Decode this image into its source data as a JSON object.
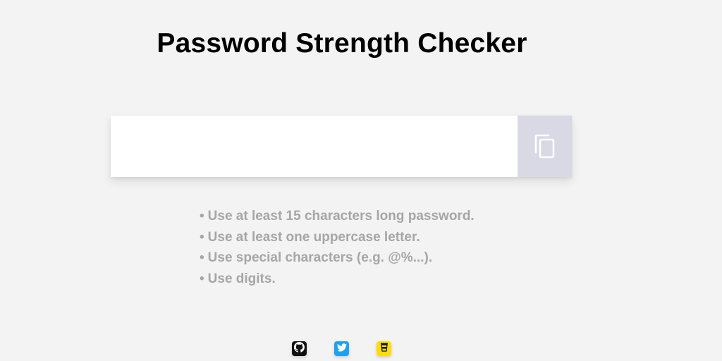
{
  "header": {
    "title": "Password Strength Checker"
  },
  "password_field": {
    "value": "",
    "placeholder": ""
  },
  "copy_button": {
    "icon": "copy-icon"
  },
  "tips": [
    "Use at least 15 characters long password.",
    "Use at least one uppercase letter.",
    "Use special characters (e.g. @%...).",
    "Use digits."
  ],
  "bullet": "•",
  "social": [
    {
      "icon": "github-icon",
      "color": "#111111"
    },
    {
      "icon": "twitter-icon",
      "color": "#1da1f2"
    },
    {
      "icon": "coffee-icon",
      "color": "#ffdd00"
    }
  ],
  "colors": {
    "background": "#f3f3f3",
    "copy_button_bg": "#d9d9e6",
    "tip_text": "#a6a6a6"
  }
}
